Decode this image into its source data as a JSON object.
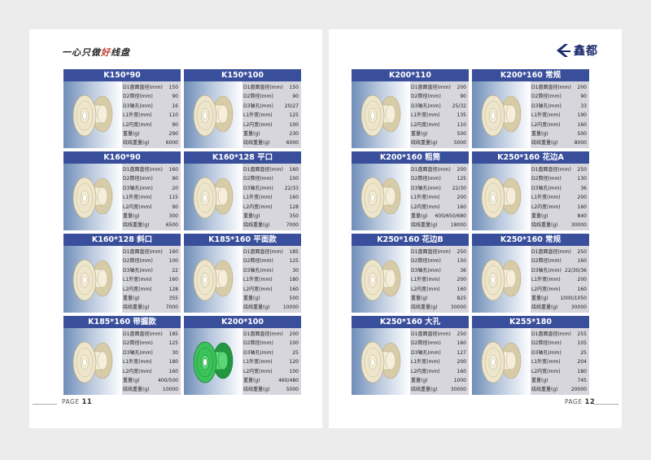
{
  "header": {
    "slogan_part1": "一心只做",
    "slogan_highlight": "好",
    "slogan_part2": "线盘",
    "brand": "鑫都"
  },
  "footer": {
    "left_label": "PAGE",
    "left_number": "11",
    "right_label": "PAGE",
    "right_number": "12"
  },
  "products": [
    {
      "title": "K150*90",
      "color": "cream",
      "rows": [
        [
          "D1盘面直径(mm)",
          "150"
        ],
        [
          "D2筒径(mm)",
          "90"
        ],
        [
          "D3轴孔(mm)",
          "16"
        ],
        [
          "L1外宽(mm)",
          "110"
        ],
        [
          "L2内宽(mm)",
          "90"
        ],
        [
          "重量(g)",
          "290"
        ],
        [
          "绕线重量(g)",
          "6000"
        ]
      ]
    },
    {
      "title": "K150*100",
      "color": "cream",
      "rows": [
        [
          "D1盘面直径(mm)",
          "150"
        ],
        [
          "D2筒径(mm)",
          "90"
        ],
        [
          "D3轴孔(mm)",
          "20/27"
        ],
        [
          "L1外宽(mm)",
          "125"
        ],
        [
          "L2内宽(mm)",
          "100"
        ],
        [
          "重量(g)",
          "230"
        ],
        [
          "绕线重量(g)",
          "6000"
        ]
      ]
    },
    {
      "title": "K160*90",
      "color": "cream",
      "rows": [
        [
          "D1盘面直径(mm)",
          "160"
        ],
        [
          "D2筒径(mm)",
          "90"
        ],
        [
          "D3轴孔(mm)",
          "20"
        ],
        [
          "L1外宽(mm)",
          "115"
        ],
        [
          "L2内宽(mm)",
          "90"
        ],
        [
          "重量(g)",
          "300"
        ],
        [
          "绕线重量(g)",
          "6500"
        ]
      ]
    },
    {
      "title": "K160*128 平口",
      "color": "cream",
      "rows": [
        [
          "D1盘面直径(mm)",
          "160"
        ],
        [
          "D2筒径(mm)",
          "100"
        ],
        [
          "D3轴孔(mm)",
          "22/33"
        ],
        [
          "L1外宽(mm)",
          "160"
        ],
        [
          "L2内宽(mm)",
          "128"
        ],
        [
          "重量(g)",
          "350"
        ],
        [
          "绕线重量(g)",
          "7000"
        ]
      ]
    },
    {
      "title": "K160*128 斜口",
      "color": "cream",
      "rows": [
        [
          "D1盘面直径(mm)",
          "160"
        ],
        [
          "D2筒径(mm)",
          "100"
        ],
        [
          "D3轴孔(mm)",
          "22"
        ],
        [
          "L1外宽(mm)",
          "160"
        ],
        [
          "L2内宽(mm)",
          "128"
        ],
        [
          "重量(g)",
          "355"
        ],
        [
          "绕线重量(g)",
          "7000"
        ]
      ]
    },
    {
      "title": "K185*160 平面款",
      "color": "cream",
      "rows": [
        [
          "D1盘面直径(mm)",
          "185"
        ],
        [
          "D2筒径(mm)",
          "125"
        ],
        [
          "D3轴孔(mm)",
          "30"
        ],
        [
          "L1外宽(mm)",
          "180"
        ],
        [
          "L2内宽(mm)",
          "160"
        ],
        [
          "重量(g)",
          "500"
        ],
        [
          "绕线重量(g)",
          "10000"
        ]
      ]
    },
    {
      "title": "K185*160 带握款",
      "color": "cream",
      "rows": [
        [
          "D1盘面直径(mm)",
          "185"
        ],
        [
          "D2筒径(mm)",
          "125"
        ],
        [
          "D3轴孔(mm)",
          "30"
        ],
        [
          "L1外宽(mm)",
          "180"
        ],
        [
          "L2内宽(mm)",
          "160"
        ],
        [
          "重量(g)",
          "400/500"
        ],
        [
          "绕线重量(g)",
          "10000"
        ]
      ]
    },
    {
      "title": "K200*100",
      "color": "green",
      "rows": [
        [
          "D1盘面直径(mm)",
          "200"
        ],
        [
          "D2筒径(mm)",
          "100"
        ],
        [
          "D3轴孔(mm)",
          "25"
        ],
        [
          "L1外宽(mm)",
          "120"
        ],
        [
          "L2内宽(mm)",
          "100"
        ],
        [
          "重量(g)",
          "460/480"
        ],
        [
          "绕线重量(g)",
          "5000"
        ]
      ]
    },
    {
      "title": "K200*110",
      "color": "cream",
      "rows": [
        [
          "D1盘面直径(mm)",
          "200"
        ],
        [
          "D2筒径(mm)",
          "90"
        ],
        [
          "D3轴孔(mm)",
          "25/32"
        ],
        [
          "L1外宽(mm)",
          "135"
        ],
        [
          "L2内宽(mm)",
          "110"
        ],
        [
          "重量(g)",
          "500"
        ],
        [
          "绕线重量(g)",
          "5000"
        ]
      ]
    },
    {
      "title": "K200*160 常规",
      "color": "cream",
      "rows": [
        [
          "D1盘面直径(mm)",
          "200"
        ],
        [
          "D2筒径(mm)",
          "90"
        ],
        [
          "D3轴孔(mm)",
          "33"
        ],
        [
          "L1外宽(mm)",
          "190"
        ],
        [
          "L2内宽(mm)",
          "160"
        ],
        [
          "重量(g)",
          "500"
        ],
        [
          "绕线重量(g)",
          "8000"
        ]
      ]
    },
    {
      "title": "K200*160 粗筒",
      "color": "cream",
      "rows": [
        [
          "D1盘面直径(mm)",
          "200"
        ],
        [
          "D2筒径(mm)",
          "125"
        ],
        [
          "D3轴孔(mm)",
          "22/30"
        ],
        [
          "L1外宽(mm)",
          "200"
        ],
        [
          "L2内宽(mm)",
          "160"
        ],
        [
          "重量(g)",
          "600/650/680"
        ],
        [
          "绕线重量(g)",
          "18000"
        ]
      ]
    },
    {
      "title": "K250*160 花边A",
      "color": "cream",
      "rows": [
        [
          "D1盘面直径(mm)",
          "250"
        ],
        [
          "D2筒径(mm)",
          "130"
        ],
        [
          "D3轴孔(mm)",
          "36"
        ],
        [
          "L1外宽(mm)",
          "200"
        ],
        [
          "L2内宽(mm)",
          "160"
        ],
        [
          "重量(g)",
          "840"
        ],
        [
          "绕线重量(g)",
          "30000"
        ]
      ]
    },
    {
      "title": "K250*160 花边B",
      "color": "cream",
      "rows": [
        [
          "D1盘面直径(mm)",
          "250"
        ],
        [
          "D2筒径(mm)",
          "150"
        ],
        [
          "D3轴孔(mm)",
          "36"
        ],
        [
          "L1外宽(mm)",
          "200"
        ],
        [
          "L2内宽(mm)",
          "160"
        ],
        [
          "重量(g)",
          "825"
        ],
        [
          "绕线重量(g)",
          "30000"
        ]
      ]
    },
    {
      "title": "K250*160 常规",
      "color": "cream",
      "rows": [
        [
          "D1盘面直径(mm)",
          "250"
        ],
        [
          "D2筒径(mm)",
          "160"
        ],
        [
          "D3轴孔(mm)",
          "22/30/36"
        ],
        [
          "L1外宽(mm)",
          "200"
        ],
        [
          "L2内宽(mm)",
          "160"
        ],
        [
          "重量(g)",
          "1000/1050"
        ],
        [
          "绕线重量(g)",
          "30000"
        ]
      ]
    },
    {
      "title": "K250*160 大孔",
      "color": "cream",
      "rows": [
        [
          "D1盘面直径(mm)",
          "250"
        ],
        [
          "D2筒径(mm)",
          "160"
        ],
        [
          "D3轴孔(mm)",
          "127"
        ],
        [
          "L1外宽(mm)",
          "200"
        ],
        [
          "L2内宽(mm)",
          "160"
        ],
        [
          "重量(g)",
          "1000"
        ],
        [
          "绕线重量(g)",
          "30000"
        ]
      ]
    },
    {
      "title": "K255*180",
      "color": "cream",
      "rows": [
        [
          "D1盘面直径(mm)",
          "255"
        ],
        [
          "D2筒径(mm)",
          "105"
        ],
        [
          "D3轴孔(mm)",
          "25"
        ],
        [
          "L1外宽(mm)",
          "204"
        ],
        [
          "L2内宽(mm)",
          "180"
        ],
        [
          "重量(g)",
          "745"
        ],
        [
          "绕线重量(g)",
          "20000"
        ]
      ]
    }
  ]
}
